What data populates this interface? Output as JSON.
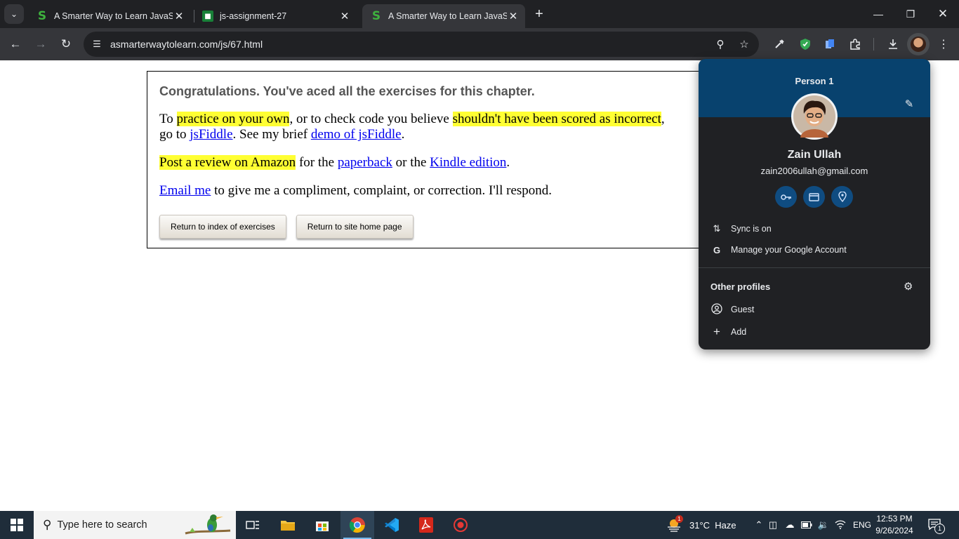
{
  "browser": {
    "tabs": [
      {
        "title": "A Smarter Way to Learn JavaScript",
        "favicon": "asmarterway-favicon",
        "active": false
      },
      {
        "title": "js-assignment-27",
        "favicon": "google-classroom-favicon",
        "active": false
      },
      {
        "title": "A Smarter Way to Learn JavaScript",
        "favicon": "asmarterway-favicon",
        "active": true
      }
    ],
    "url": "asmarterwaytolearn.com/js/67.html"
  },
  "page": {
    "heading": "Congratulations. You've aced all the exercises for this chapter.",
    "p1": {
      "t1": "To ",
      "h1": "practice on your own",
      "t2": ", or to check code you believe ",
      "h2": "shouldn't have been scored as incorrect",
      "t3": ",",
      "t4": "go to ",
      "l1": "jsFiddle",
      "t5": ". See my brief ",
      "l2": "demo of jsFiddle",
      "t6": "."
    },
    "p2": {
      "h1": "Post a review on Amazon",
      "t1": " for the ",
      "l1": "paperback",
      "t2": " or the ",
      "l2": "Kindle edition",
      "t3": "."
    },
    "p3": {
      "l1": "Email me",
      "t1": " to give me a compliment, complaint, or correction. I'll respond."
    },
    "buttons": {
      "index": "Return to index of exercises",
      "home": "Return to site home page"
    },
    "highlight_color": "#ffff33"
  },
  "profile_menu": {
    "header_label": "Person 1",
    "name": "Zain Ullah",
    "email": "zain2006ullah@gmail.com",
    "quick_actions": [
      "passwords-key-icon",
      "payment-card-icon",
      "addresses-pin-icon"
    ],
    "sync": "Sync is on",
    "manage": "Manage your Google Account",
    "other_profiles": "Other profiles",
    "guest": "Guest",
    "add": "Add",
    "header_color": "#08426e"
  },
  "taskbar": {
    "search_placeholder": "Type here to search",
    "weather": "31°C  Haze",
    "weather_badge": "1",
    "language": "ENG",
    "time": "12:53 PM",
    "date": "9/26/2024",
    "notifications": "1"
  }
}
